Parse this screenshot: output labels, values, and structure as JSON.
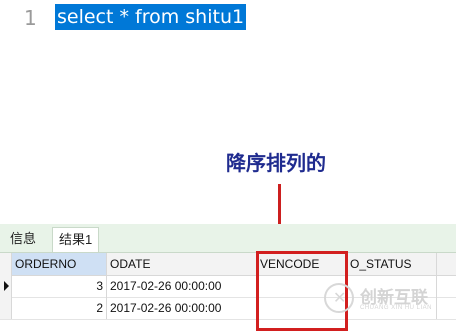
{
  "editor": {
    "line_number": "1",
    "code": "select * from shitu1"
  },
  "annotation": {
    "text": "降序排列的",
    "color": "#1f2b8f",
    "arrow_color": "#cc1f1f"
  },
  "tabs": [
    {
      "label": "信息",
      "selected": false
    },
    {
      "label": "结果1",
      "selected": true
    }
  ],
  "grid": {
    "columns": [
      "ORDERNO",
      "ODATE",
      "VENCODE",
      "O_STATUS"
    ],
    "rows": [
      {
        "orderno": "3",
        "odate": "2017-02-26 00:00:00",
        "vencode": "",
        "status": ""
      },
      {
        "orderno": "2",
        "odate": "2017-02-26 00:00:00",
        "vencode": "",
        "status": ""
      }
    ]
  },
  "watermark": {
    "text": "创新互联",
    "subtext": "CHUANG XIN HU LIAN"
  }
}
